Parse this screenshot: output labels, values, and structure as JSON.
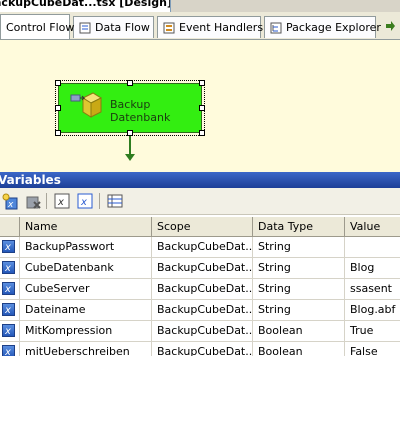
{
  "document_tab": {
    "title": "ackupCubeDat...tsx [Design]*"
  },
  "designer_tabs": [
    {
      "label": "Control Flow",
      "icon": "control-flow-icon"
    },
    {
      "label": "Data Flow",
      "icon": "data-flow-icon"
    },
    {
      "label": "Event Handlers",
      "icon": "event-handlers-icon"
    },
    {
      "label": "Package Explorer",
      "icon": "package-explorer-icon"
    }
  ],
  "canvas": {
    "task": {
      "line1": "Backup",
      "line2": "Datenbank",
      "icon": "analysis-services-task-icon"
    }
  },
  "variables_pane": {
    "title": "Variables",
    "toolbar": [
      "add-variable-icon",
      "delete-variable-icon",
      "show-system-variables-icon",
      "show-all-variables-icon",
      "choose-columns-icon"
    ],
    "columns": {
      "name": "Name",
      "scope": "Scope",
      "data_type": "Data Type",
      "value": "Value"
    },
    "rows": [
      {
        "name": "BackupPasswort",
        "scope": "BackupCubeDat...",
        "data_type": "String",
        "value": ""
      },
      {
        "name": "CubeDatenbank",
        "scope": "BackupCubeDat...",
        "data_type": "String",
        "value": "Blog"
      },
      {
        "name": "CubeServer",
        "scope": "BackupCubeDat...",
        "data_type": "String",
        "value": "ssasent"
      },
      {
        "name": "Dateiname",
        "scope": "BackupCubeDat...",
        "data_type": "String",
        "value": "Blog.abf"
      },
      {
        "name": "MitKompression",
        "scope": "BackupCubeDat...",
        "data_type": "Boolean",
        "value": "True"
      },
      {
        "name": "mitUeberschreiben",
        "scope": "BackupCubeDat...",
        "data_type": "Boolean",
        "value": "False"
      }
    ]
  },
  "colors": {
    "task_fill": "#33ee11",
    "canvas": "#fffbdc",
    "pane_title": "#2a4fae"
  }
}
